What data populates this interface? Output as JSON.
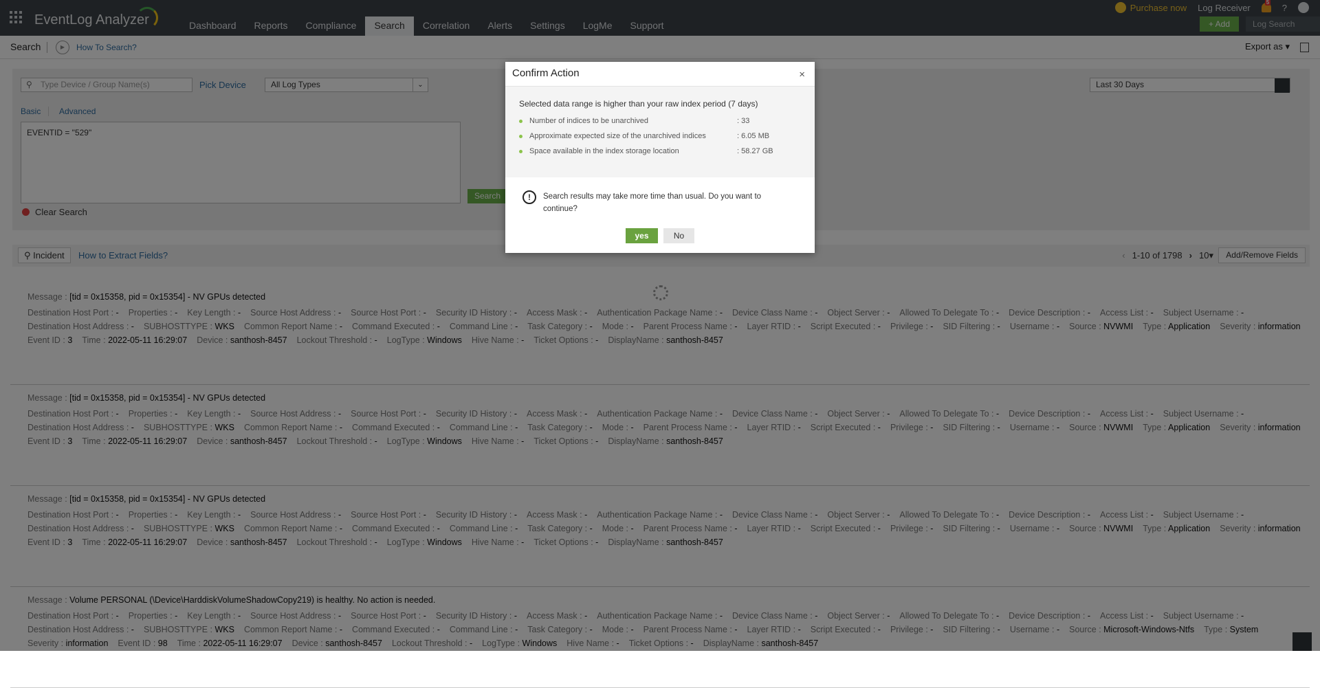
{
  "app": {
    "title": "EventLog Analyzer"
  },
  "nav": {
    "items": [
      "Dashboard",
      "Reports",
      "Compliance",
      "Search",
      "Correlation",
      "Alerts",
      "Settings",
      "LogMe",
      "Support"
    ],
    "active": "Search"
  },
  "topright": {
    "purchase": "Purchase now",
    "log_receiver": "Log Receiver",
    "notif_count": "5",
    "help": "?",
    "add": "+ Add",
    "log_search": "Log Search"
  },
  "subheader": {
    "title": "Search",
    "how_to": "How To Search?",
    "export": "Export as ▾"
  },
  "search": {
    "device_placeholder": "Type Device / Group Name(s)",
    "pick_device": "Pick Device",
    "log_type": "All Log Types",
    "tabs": [
      "Basic",
      "Advanced"
    ],
    "query": "EVENTID = \"529\"",
    "search_button": "Search",
    "clear": "Clear Search",
    "date_range": "Last 30 Days"
  },
  "results": {
    "incident": "Incident",
    "extract": "How to Extract Fields?",
    "range": "1-10 of 1798",
    "per_page": "10▾",
    "add_remove": "Add/Remove Fields",
    "records": [
      {
        "message": "[tid = 0x15358, pid = 0x15354] - NV GPUs detected",
        "lines": [
          [
            [
              "Destination Host Port",
              "-"
            ],
            [
              "Properties",
              "-"
            ],
            [
              "Key Length",
              "-"
            ],
            [
              "Source Host Address",
              "-"
            ],
            [
              "Source Host Port",
              "-"
            ],
            [
              "Security ID History",
              "-"
            ],
            [
              "Access Mask",
              "-"
            ],
            [
              "Authentication Package Name",
              "-"
            ],
            [
              "Device Class Name",
              "-"
            ],
            [
              "Object Server",
              "-"
            ],
            [
              "Allowed To Delegate To",
              "-"
            ],
            [
              "Device Description",
              "-"
            ],
            [
              "Access List",
              "-"
            ],
            [
              "Subject Username",
              "-"
            ]
          ],
          [
            [
              "Destination Host Address",
              "-"
            ],
            [
              "SUBHOSTTYPE",
              "WKS"
            ],
            [
              "Common Report Name",
              "-"
            ],
            [
              "Command Executed",
              "-"
            ],
            [
              "Command Line",
              "-"
            ],
            [
              "Task Category",
              "-"
            ],
            [
              "Mode",
              "-"
            ],
            [
              "Parent Process Name",
              "-"
            ],
            [
              "Layer RTID",
              "-"
            ],
            [
              "Script Executed",
              "-"
            ],
            [
              "Privilege",
              "-"
            ],
            [
              "SID Filtering",
              "-"
            ],
            [
              "Username",
              "-"
            ],
            [
              "Source",
              "NVWMI"
            ],
            [
              "Type",
              "Application"
            ],
            [
              "Severity",
              "information"
            ]
          ],
          [
            [
              "Event ID",
              "3"
            ],
            [
              "Time",
              "2022-05-11 16:29:07"
            ],
            [
              "Device",
              "santhosh-8457"
            ],
            [
              "Lockout Threshold",
              "-"
            ],
            [
              "LogType",
              "Windows"
            ],
            [
              "Hive Name",
              "-"
            ],
            [
              "Ticket Options",
              "-"
            ],
            [
              "DisplayName",
              "santhosh-8457"
            ]
          ]
        ]
      },
      {
        "message": "[tid = 0x15358, pid = 0x15354] - NV GPUs detected",
        "lines": [
          [
            [
              "Destination Host Port",
              "-"
            ],
            [
              "Properties",
              "-"
            ],
            [
              "Key Length",
              "-"
            ],
            [
              "Source Host Address",
              "-"
            ],
            [
              "Source Host Port",
              "-"
            ],
            [
              "Security ID History",
              "-"
            ],
            [
              "Access Mask",
              "-"
            ],
            [
              "Authentication Package Name",
              "-"
            ],
            [
              "Device Class Name",
              "-"
            ],
            [
              "Object Server",
              "-"
            ],
            [
              "Allowed To Delegate To",
              "-"
            ],
            [
              "Device Description",
              "-"
            ],
            [
              "Access List",
              "-"
            ],
            [
              "Subject Username",
              "-"
            ]
          ],
          [
            [
              "Destination Host Address",
              "-"
            ],
            [
              "SUBHOSTTYPE",
              "WKS"
            ],
            [
              "Common Report Name",
              "-"
            ],
            [
              "Command Executed",
              "-"
            ],
            [
              "Command Line",
              "-"
            ],
            [
              "Task Category",
              "-"
            ],
            [
              "Mode",
              "-"
            ],
            [
              "Parent Process Name",
              "-"
            ],
            [
              "Layer RTID",
              "-"
            ],
            [
              "Script Executed",
              "-"
            ],
            [
              "Privilege",
              "-"
            ],
            [
              "SID Filtering",
              "-"
            ],
            [
              "Username",
              "-"
            ],
            [
              "Source",
              "NVWMI"
            ],
            [
              "Type",
              "Application"
            ],
            [
              "Severity",
              "information"
            ]
          ],
          [
            [
              "Event ID",
              "3"
            ],
            [
              "Time",
              "2022-05-11 16:29:07"
            ],
            [
              "Device",
              "santhosh-8457"
            ],
            [
              "Lockout Threshold",
              "-"
            ],
            [
              "LogType",
              "Windows"
            ],
            [
              "Hive Name",
              "-"
            ],
            [
              "Ticket Options",
              "-"
            ],
            [
              "DisplayName",
              "santhosh-8457"
            ]
          ]
        ]
      },
      {
        "message": "[tid = 0x15358, pid = 0x15354] - NV GPUs detected",
        "lines": [
          [
            [
              "Destination Host Port",
              "-"
            ],
            [
              "Properties",
              "-"
            ],
            [
              "Key Length",
              "-"
            ],
            [
              "Source Host Address",
              "-"
            ],
            [
              "Source Host Port",
              "-"
            ],
            [
              "Security ID History",
              "-"
            ],
            [
              "Access Mask",
              "-"
            ],
            [
              "Authentication Package Name",
              "-"
            ],
            [
              "Device Class Name",
              "-"
            ],
            [
              "Object Server",
              "-"
            ],
            [
              "Allowed To Delegate To",
              "-"
            ],
            [
              "Device Description",
              "-"
            ],
            [
              "Access List",
              "-"
            ],
            [
              "Subject Username",
              "-"
            ]
          ],
          [
            [
              "Destination Host Address",
              "-"
            ],
            [
              "SUBHOSTTYPE",
              "WKS"
            ],
            [
              "Common Report Name",
              "-"
            ],
            [
              "Command Executed",
              "-"
            ],
            [
              "Command Line",
              "-"
            ],
            [
              "Task Category",
              "-"
            ],
            [
              "Mode",
              "-"
            ],
            [
              "Parent Process Name",
              "-"
            ],
            [
              "Layer RTID",
              "-"
            ],
            [
              "Script Executed",
              "-"
            ],
            [
              "Privilege",
              "-"
            ],
            [
              "SID Filtering",
              "-"
            ],
            [
              "Username",
              "-"
            ],
            [
              "Source",
              "NVWMI"
            ],
            [
              "Type",
              "Application"
            ],
            [
              "Severity",
              "information"
            ]
          ],
          [
            [
              "Event ID",
              "3"
            ],
            [
              "Time",
              "2022-05-11 16:29:07"
            ],
            [
              "Device",
              "santhosh-8457"
            ],
            [
              "Lockout Threshold",
              "-"
            ],
            [
              "LogType",
              "Windows"
            ],
            [
              "Hive Name",
              "-"
            ],
            [
              "Ticket Options",
              "-"
            ],
            [
              "DisplayName",
              "santhosh-8457"
            ]
          ]
        ]
      },
      {
        "message": "Volume PERSONAL (\\Device\\HarddiskVolumeShadowCopy219) is healthy. No action is needed.",
        "lines": [
          [
            [
              "Destination Host Port",
              "-"
            ],
            [
              "Properties",
              "-"
            ],
            [
              "Key Length",
              "-"
            ],
            [
              "Source Host Address",
              "-"
            ],
            [
              "Source Host Port",
              "-"
            ],
            [
              "Security ID History",
              "-"
            ],
            [
              "Access Mask",
              "-"
            ],
            [
              "Authentication Package Name",
              "-"
            ],
            [
              "Device Class Name",
              "-"
            ],
            [
              "Object Server",
              "-"
            ],
            [
              "Allowed To Delegate To",
              "-"
            ],
            [
              "Device Description",
              "-"
            ],
            [
              "Access List",
              "-"
            ],
            [
              "Subject Username",
              "-"
            ]
          ],
          [
            [
              "Destination Host Address",
              "-"
            ],
            [
              "SUBHOSTTYPE",
              "WKS"
            ],
            [
              "Common Report Name",
              "-"
            ],
            [
              "Command Executed",
              "-"
            ],
            [
              "Command Line",
              "-"
            ],
            [
              "Task Category",
              "-"
            ],
            [
              "Mode",
              "-"
            ],
            [
              "Parent Process Name",
              "-"
            ],
            [
              "Layer RTID",
              "-"
            ],
            [
              "Script Executed",
              "-"
            ],
            [
              "Privilege",
              "-"
            ],
            [
              "SID Filtering",
              "-"
            ],
            [
              "Username",
              "-"
            ],
            [
              "Source",
              "Microsoft-Windows-Ntfs"
            ],
            [
              "Type",
              "System"
            ]
          ],
          [
            [
              "Severity",
              "information"
            ],
            [
              "Event ID",
              "98"
            ],
            [
              "Time",
              "2022-05-11 16:29:07"
            ],
            [
              "Device",
              "santhosh-8457"
            ],
            [
              "Lockout Threshold",
              "-"
            ],
            [
              "LogType",
              "Windows"
            ],
            [
              "Hive Name",
              "-"
            ],
            [
              "Ticket Options",
              "-"
            ],
            [
              "DisplayName",
              "santhosh-8457"
            ]
          ]
        ]
      }
    ]
  },
  "dialog": {
    "title": "Confirm Action",
    "close": "×",
    "heading": "Selected data range is higher than your raw index period (7 days)",
    "items": [
      {
        "label": "Number of indices to be unarchived",
        "value": ": 33"
      },
      {
        "label": "Approximate expected size of the unarchived indices",
        "value": ": 6.05 MB"
      },
      {
        "label": "Space available in the index storage location",
        "value": ": 58.27 GB"
      }
    ],
    "warning": "Search results may take more time than usual. Do you want to continue?",
    "warning_icon": "!",
    "yes": "yes",
    "no": "No"
  },
  "colors": {
    "accent_green": "#6ab14a",
    "topbar": "#3c4349",
    "link": "#2d6a9f"
  }
}
